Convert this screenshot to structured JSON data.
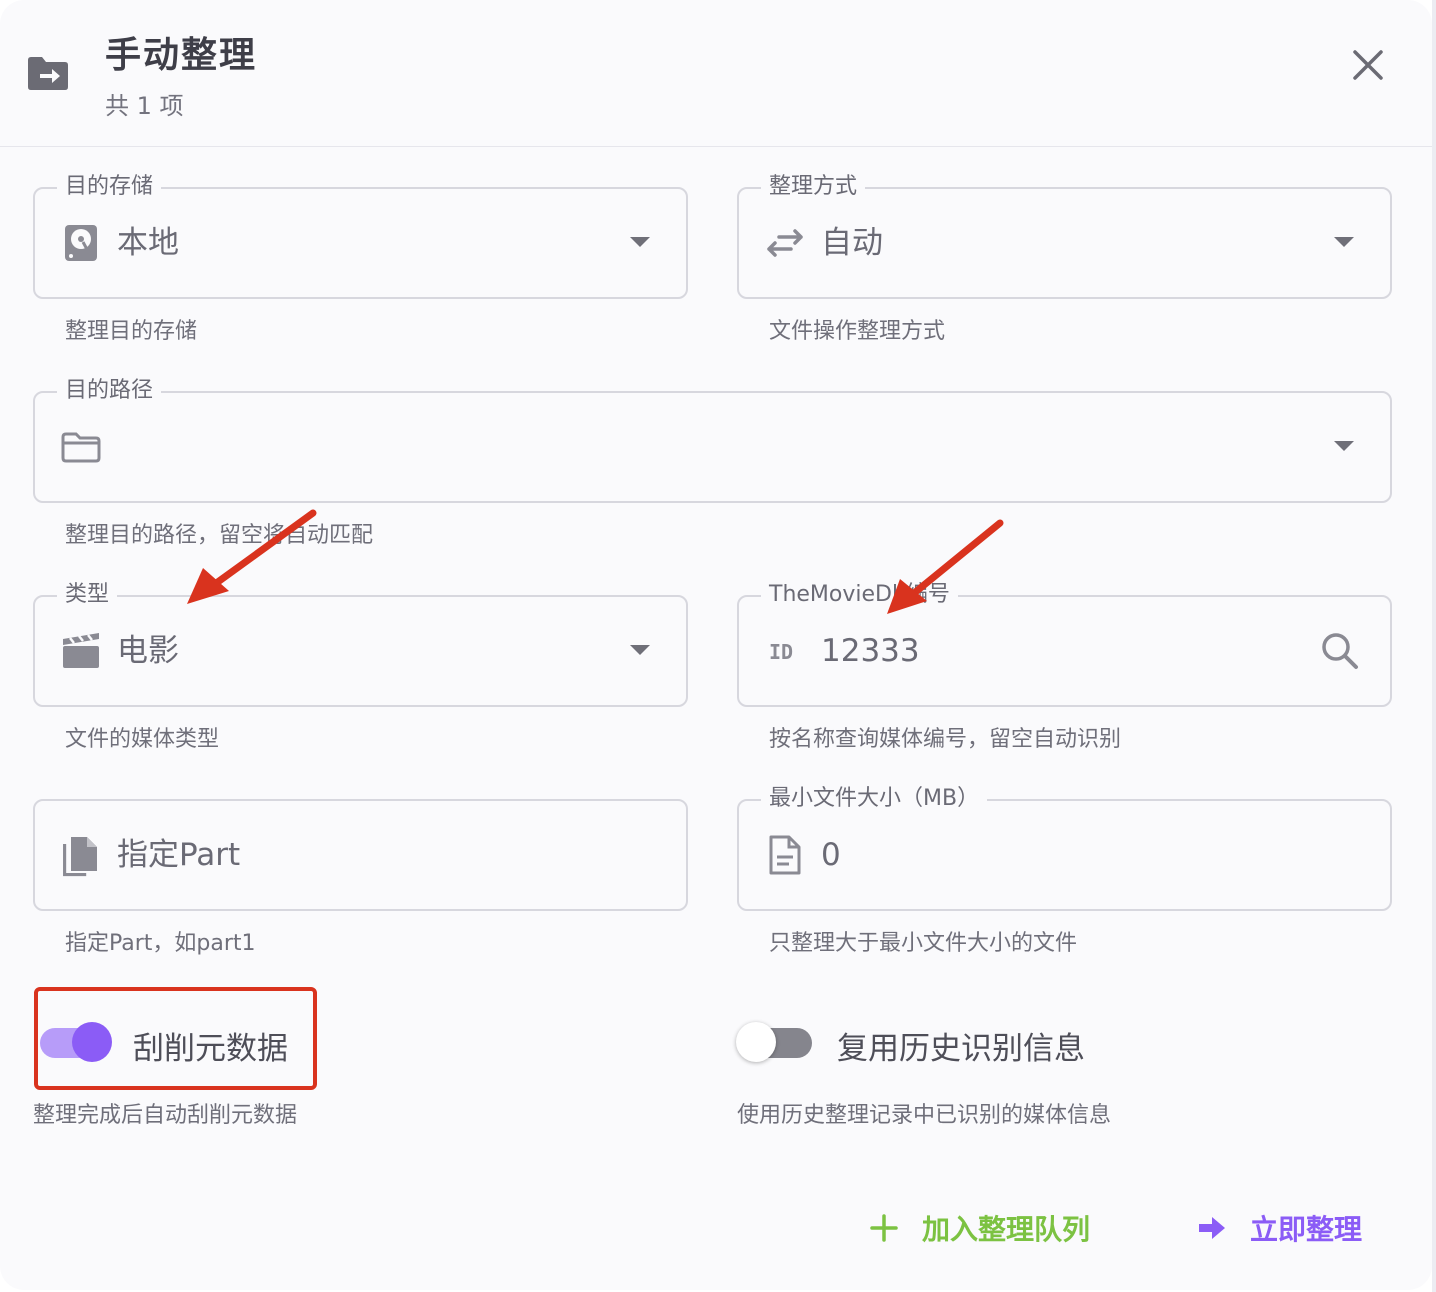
{
  "dialog": {
    "title": "手动整理",
    "subtitle": "共 1 项"
  },
  "fields": {
    "storage": {
      "label": "目的存储",
      "value": "本地",
      "hint": "整理目的存储",
      "icon": "hard-disk-icon"
    },
    "method": {
      "label": "整理方式",
      "value": "自动",
      "hint": "文件操作整理方式",
      "icon": "swap-arrows-icon"
    },
    "path": {
      "label": "目的路径",
      "value": "",
      "hint": "整理目的路径，留空将自动匹配",
      "icon": "folder-icon"
    },
    "type": {
      "label": "类型",
      "value": "电影",
      "hint": "文件的媒体类型",
      "icon": "clapperboard-icon"
    },
    "tmdb": {
      "label": "TheMovieDb编号",
      "value": "12333",
      "hint": "按名称查询媒体编号，留空自动识别",
      "icon": "id-badge-icon"
    },
    "part": {
      "placeholder": "指定Part",
      "value": "",
      "hint": "指定Part，如part1",
      "icon": "file-copy-icon"
    },
    "min_size": {
      "label": "最小文件大小（MB）",
      "value": "0",
      "hint": "只整理大于最小文件大小的文件",
      "icon": "file-document-icon"
    }
  },
  "toggles": {
    "scrape": {
      "label": "刮削元数据",
      "hint": "整理完成后自动刮削元数据",
      "on": true
    },
    "reuse": {
      "label": "复用历史识别信息",
      "hint": "使用历史整理记录中已识别的媒体信息",
      "on": false
    }
  },
  "actions": {
    "queue_label": "加入整理队列",
    "now_label": "立即整理"
  },
  "colors": {
    "accent": "#8b5cf6",
    "queue_green": "#7cc242",
    "annotation_red": "#d9331e"
  }
}
